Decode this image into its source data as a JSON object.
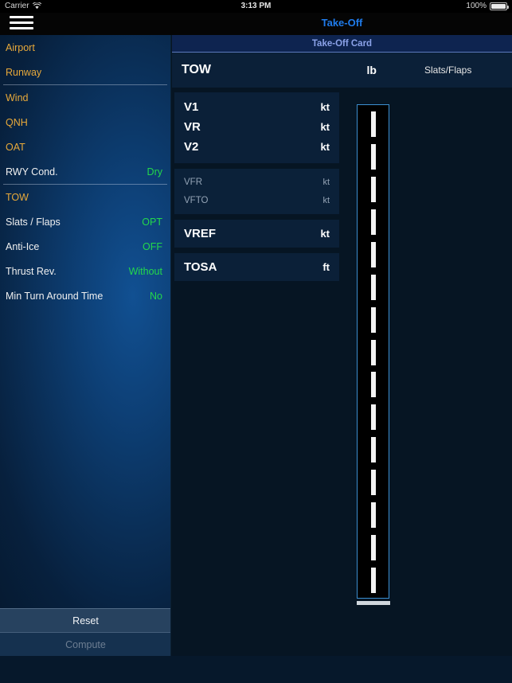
{
  "statusbar": {
    "carrier": "Carrier",
    "time": "3:13 PM",
    "battery": "100%",
    "wifi_icon": "wifi-icon",
    "battery_icon": "battery-icon"
  },
  "navbar": {
    "menu_icon": "hamburger-menu-icon",
    "title": "Take-Off"
  },
  "sidebar": {
    "items": [
      {
        "label": "Airport",
        "value": "",
        "style": "amber"
      },
      {
        "label": "Runway",
        "value": "",
        "style": "amber"
      },
      {
        "label": "Wind",
        "value": "",
        "style": "amber"
      },
      {
        "label": "QNH",
        "value": "",
        "style": "amber"
      },
      {
        "label": "OAT",
        "value": "",
        "style": "amber"
      },
      {
        "label": "RWY Cond.",
        "value": "Dry",
        "style": "white"
      },
      {
        "label": "TOW",
        "value": "",
        "style": "amber"
      },
      {
        "label": "Slats / Flaps",
        "value": "OPT",
        "style": "white"
      },
      {
        "label": "Anti-Ice",
        "value": "OFF",
        "style": "white"
      },
      {
        "label": "Thrust Rev.",
        "value": "Without",
        "style": "white"
      },
      {
        "label": "Min Turn Around Time",
        "value": "No",
        "style": "white"
      }
    ],
    "reset_label": "Reset",
    "compute_label": "Compute"
  },
  "card": {
    "title": "Take-Off Card",
    "tow": {
      "name": "TOW",
      "unit": "lb",
      "slats_flaps_label": "Slats/Flaps"
    },
    "vspeeds": [
      {
        "name": "V1",
        "unit": "kt"
      },
      {
        "name": "VR",
        "unit": "kt"
      },
      {
        "name": "V2",
        "unit": "kt"
      }
    ],
    "secondary": [
      {
        "name": "VFR",
        "unit": "kt"
      },
      {
        "name": "VFTO",
        "unit": "kt"
      }
    ],
    "vref": {
      "name": "VREF",
      "unit": "kt"
    },
    "tosa": {
      "name": "TOSA",
      "unit": "ft"
    }
  },
  "runway_graphic": {
    "name": "runway-diagram",
    "dash_count": 15
  },
  "colors": {
    "accent_blue": "#1f7bea",
    "card_title": "#8ba2e8",
    "amber": "#e8a93a",
    "green": "#23d84b",
    "runway_border": "#3c8fd0"
  }
}
